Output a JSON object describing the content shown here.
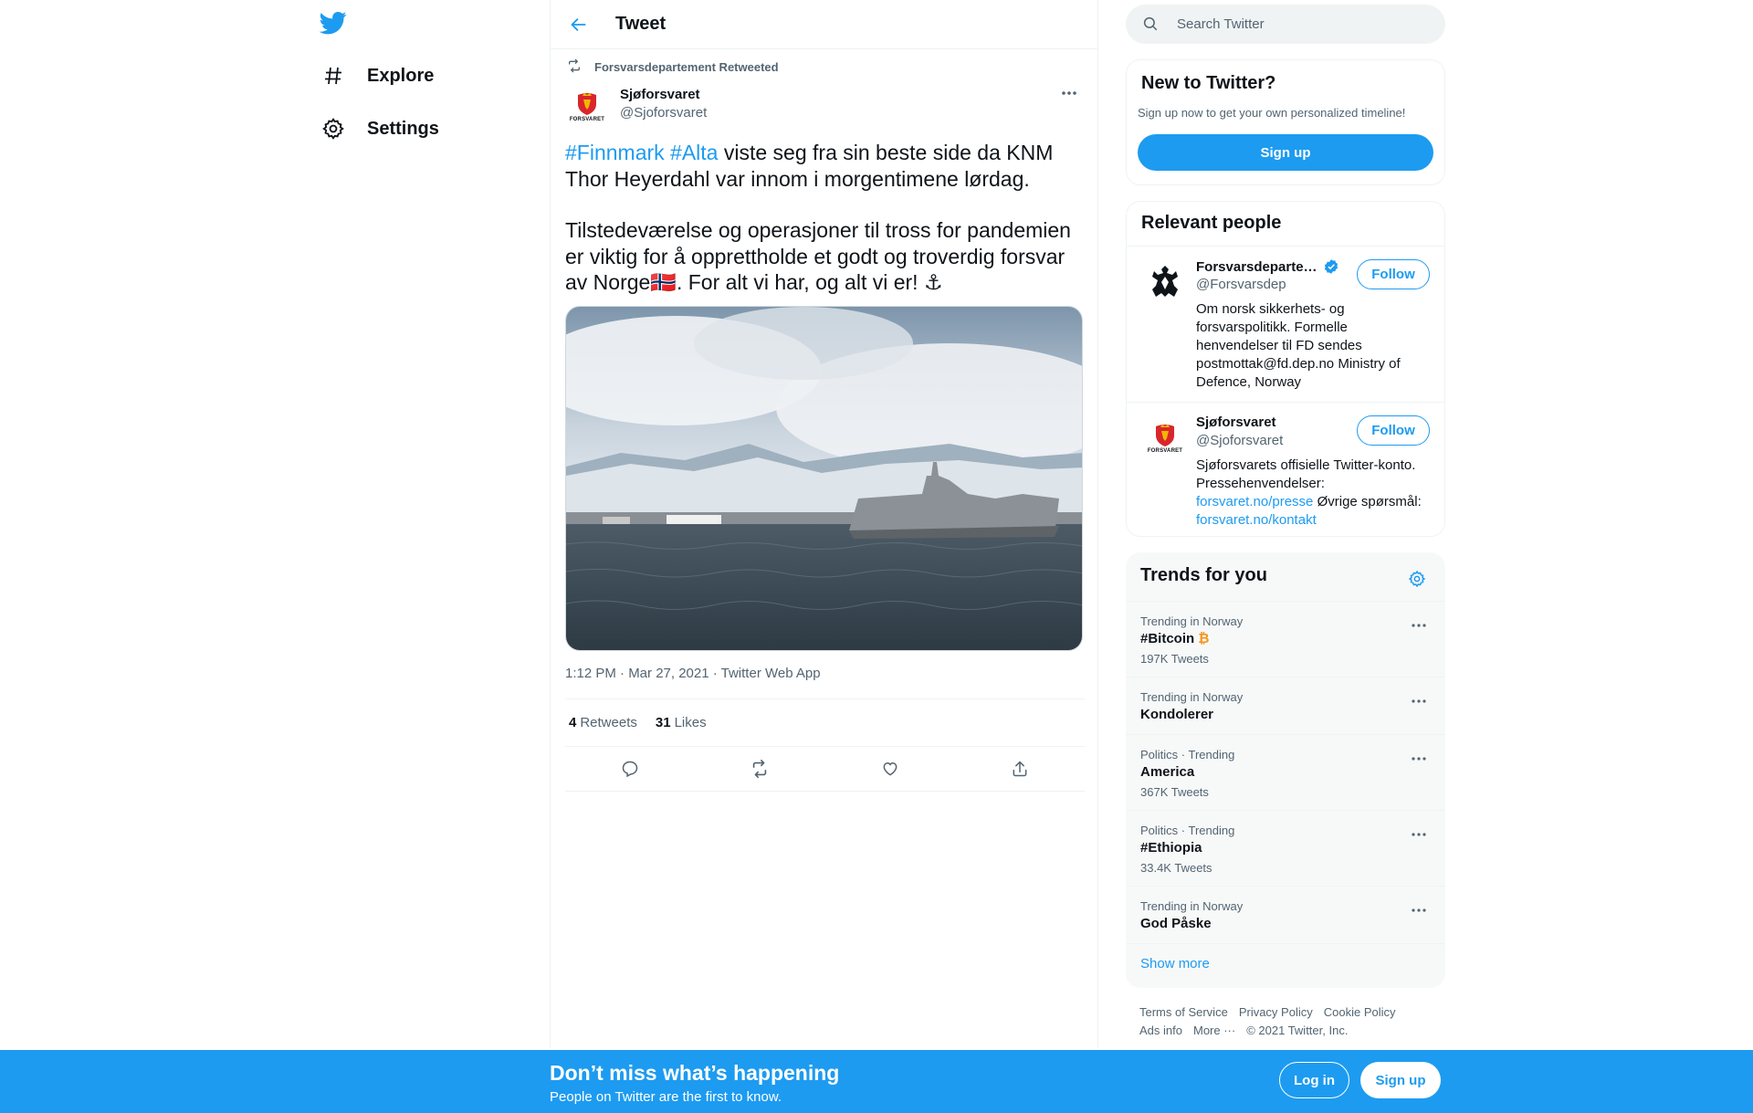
{
  "nav": {
    "items": [
      {
        "label": "Explore",
        "icon": "hashtag-icon"
      },
      {
        "label": "Settings",
        "icon": "gear-icon"
      }
    ]
  },
  "header": {
    "title": "Tweet"
  },
  "tweet": {
    "retweeted_by": "Forsvarsdepartement Retweeted",
    "author_name": "Sjøforsvaret",
    "author_handle": "@Sjoforsvaret",
    "avatar_text": "FORSVARET",
    "text_p1_tags": [
      "#Finnmark",
      "#Alta"
    ],
    "text_p1_rest": " viste seg fra sin beste side da KNM Thor Heyerdahl var innom i morgentimene lørdag.",
    "text_p2": "Tilstedeværelse og operasjoner til tross for pandemien er viktig for å opprettholde et godt og troverdig forsvar av Norge🇳🇴. For alt vi har, og alt vi er! ⚓",
    "meta": "1:12 PM · Mar 27, 2021 · Twitter Web App",
    "retweets_count": "4",
    "retweets_label": "Retweets",
    "likes_count": "31",
    "likes_label": "Likes"
  },
  "search": {
    "placeholder": "Search Twitter"
  },
  "new_to_twitter": {
    "title": "New to Twitter?",
    "subtitle": "Sign up now to get your own personalized timeline!",
    "button": "Sign up"
  },
  "relevant_people": {
    "title": "Relevant people",
    "people": [
      {
        "name": "Forsvarsdeparte…",
        "handle": "@Forsvarsdep",
        "verified": true,
        "follow_label": "Follow",
        "bio": "Om norsk sikkerhets- og forsvarspolitikk. Formelle henvendelser til FD sendes postmottak@fd.dep.no Ministry of Defence, Norway"
      },
      {
        "name": "Sjøforsvaret",
        "handle": "@Sjoforsvaret",
        "verified": false,
        "follow_label": "Follow",
        "avatar_text": "FORSVARET",
        "bio_text1": "Sjøforsvarets offisielle Twitter-konto. Pressehenvendelser: ",
        "bio_link1": "forsvaret.no/presse",
        "bio_text2": " Øvrige spørsmål: ",
        "bio_link2": "forsvaret.no/kontakt"
      }
    ]
  },
  "trends": {
    "title": "Trends for you",
    "items": [
      {
        "context": "Trending in Norway",
        "name": "#Bitcoin",
        "emoji": "₿",
        "count": "197K Tweets"
      },
      {
        "context": "Trending in Norway",
        "name": "Kondolerer",
        "count": ""
      },
      {
        "context": "Politics · Trending",
        "name": "America",
        "count": "367K Tweets"
      },
      {
        "context": "Politics · Trending",
        "name": "#Ethiopia",
        "count": "33.4K Tweets"
      },
      {
        "context": "Trending in Norway",
        "name": "God Påske",
        "count": ""
      }
    ],
    "show_more": "Show more"
  },
  "footer": {
    "links": [
      "Terms of Service",
      "Privacy Policy",
      "Cookie Policy",
      "Ads info",
      "More ···",
      "© 2021 Twitter, Inc."
    ]
  },
  "bottom_bar": {
    "title": "Don’t miss what’s happening",
    "subtitle": "People on Twitter are the first to know.",
    "login": "Log in",
    "signup": "Sign up"
  },
  "colors": {
    "accent": "#1d9bf0",
    "text": "#0f1419",
    "muted": "#536471"
  }
}
